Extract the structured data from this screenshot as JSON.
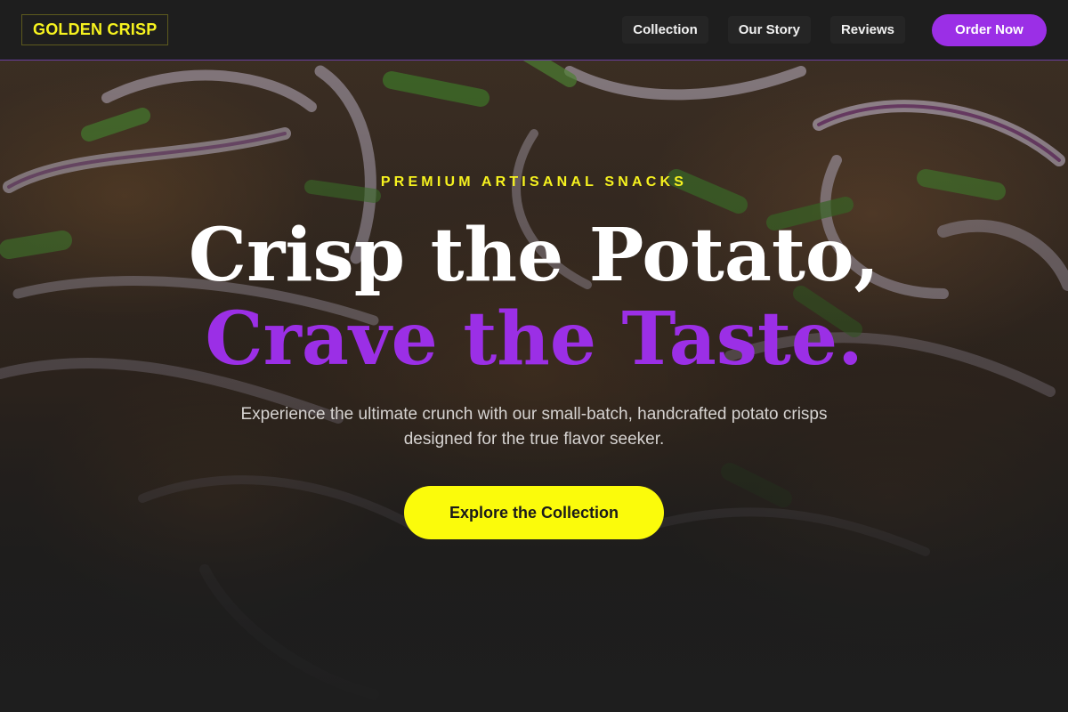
{
  "brand": {
    "logo_text": "GOLDEN CRISP"
  },
  "nav": {
    "links": [
      {
        "label": "Collection"
      },
      {
        "label": "Our Story"
      },
      {
        "label": "Reviews"
      }
    ],
    "order_label": "Order Now"
  },
  "hero": {
    "eyebrow": "PREMIUM ARTISANAL SNACKS",
    "headline_line1": "Crisp the Potato,",
    "headline_line2": "Crave the Taste.",
    "subtitle": "Experience the ultimate crunch with our small-batch, handcrafted potato crisps designed for the true flavor seeker.",
    "cta_label": "Explore the Collection"
  },
  "colors": {
    "accent_purple": "#9b2fe6",
    "accent_yellow": "#f6f21f",
    "cta_yellow": "#fbfb0b",
    "navbar_bg": "#1e1e1e"
  }
}
